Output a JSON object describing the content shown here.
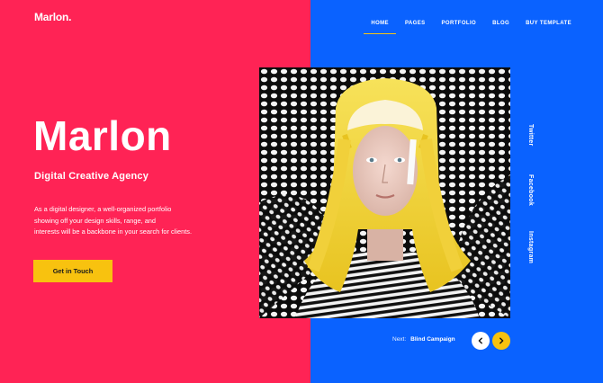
{
  "brand": {
    "logo_text": "Marlon."
  },
  "nav": {
    "items": [
      {
        "label": "HOME",
        "active": true
      },
      {
        "label": "PAGES",
        "active": false
      },
      {
        "label": "PORTFOLIO",
        "active": false
      },
      {
        "label": "BLOG",
        "active": false
      },
      {
        "label": "BUY TEMPLATE",
        "active": false
      }
    ]
  },
  "hero": {
    "title": "Marlon",
    "subtitle": "Digital Creative Agency",
    "description_lines": [
      "As a digital designer, a well-organized portfolio",
      "showing off your design skills, range, and",
      "interests will be a backbone in your search for clients."
    ],
    "cta_label": "Get in Touch"
  },
  "social": [
    "Twitter",
    "Facebook",
    "Instagram"
  ],
  "pager": {
    "next_label": "Next:",
    "next_title": "Blind Campaign",
    "prev_icon": "chevron-left-icon",
    "next_icon": "chevron-right-icon"
  },
  "colors": {
    "left_bg": "#ff2355",
    "right_bg": "#0a62ff",
    "accent": "#f8c20f"
  }
}
